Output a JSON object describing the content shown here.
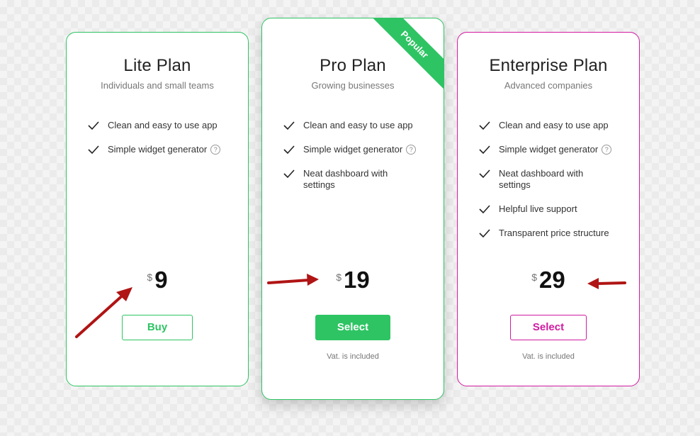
{
  "colors": {
    "green": "#2ec463",
    "magenta": "#d11aa0",
    "arrow": "#b01414"
  },
  "plans": [
    {
      "title": "Lite Plan",
      "subtitle": "Individuals and small teams",
      "features": [
        {
          "text": "Clean and easy to use app",
          "help": false
        },
        {
          "text": "Simple widget generator",
          "help": true
        }
      ],
      "currency": "$",
      "price": "9",
      "button": "Buy"
    },
    {
      "title": "Pro Plan",
      "subtitle": "Growing businesses",
      "badge": "Popular",
      "features": [
        {
          "text": "Clean and easy to use app",
          "help": false
        },
        {
          "text": "Simple widget generator",
          "help": true
        },
        {
          "text": "Neat dashboard with settings",
          "help": false
        }
      ],
      "currency": "$",
      "price": "19",
      "button": "Select",
      "note": "Vat. is included"
    },
    {
      "title": "Enterprise Plan",
      "subtitle": "Advanced companies",
      "features": [
        {
          "text": "Clean and easy to use app",
          "help": false
        },
        {
          "text": "Simple widget generator",
          "help": true
        },
        {
          "text": "Neat dashboard with settings",
          "help": false
        },
        {
          "text": "Helpful live support",
          "help": false
        },
        {
          "text": "Transparent price structure",
          "help": false
        }
      ],
      "currency": "$",
      "price": "29",
      "button": "Select",
      "note": "Vat. is included"
    }
  ],
  "help_icon_glyph": "?",
  "annotations": [
    "red-arrow",
    "red-arrow",
    "red-arrow"
  ]
}
